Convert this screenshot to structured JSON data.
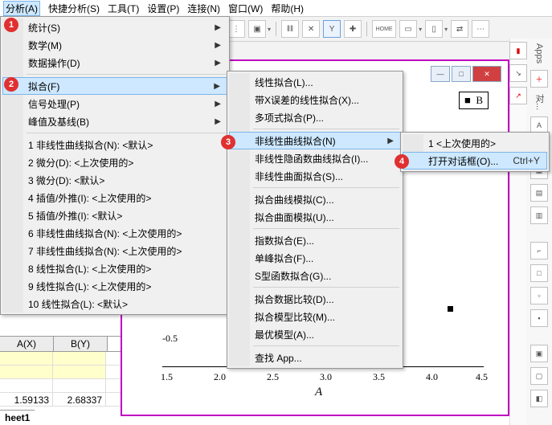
{
  "menubar": {
    "items": [
      "分析(A)",
      "快捷分析(S)",
      "工具(T)",
      "设置(P)",
      "连接(N)",
      "窗口(W)",
      "帮助(H)"
    ]
  },
  "menu1": {
    "items": [
      {
        "label": "统计(S)",
        "arrow": true
      },
      {
        "label": "数学(M)",
        "arrow": true
      },
      {
        "label": "数据操作(D)",
        "arrow": true
      },
      {
        "sep": true
      },
      {
        "label": "拟合(F)",
        "arrow": true,
        "sel": true
      },
      {
        "label": "信号处理(P)",
        "arrow": true
      },
      {
        "label": "峰值及基线(B)",
        "arrow": true
      },
      {
        "sep": true
      },
      {
        "label": "1 非线性曲线拟合(N): <默认>"
      },
      {
        "label": "2 微分(D): <上次使用的>"
      },
      {
        "label": "3 微分(D): <默认>"
      },
      {
        "label": "4 插值/外推(I): <上次使用的>"
      },
      {
        "label": "5 插值/外推(I): <默认>"
      },
      {
        "label": "6 非线性曲线拟合(N): <上次使用的>"
      },
      {
        "label": "7 非线性曲线拟合(N): <上次使用的>"
      },
      {
        "label": "8 线性拟合(L): <上次使用的>"
      },
      {
        "label": "9 线性拟合(L): <上次使用的>"
      },
      {
        "label": "10 线性拟合(L): <默认>"
      }
    ]
  },
  "menu2": {
    "items": [
      {
        "label": "线性拟合(L)..."
      },
      {
        "label": "带X误差的线性拟合(X)..."
      },
      {
        "label": "多项式拟合(P)..."
      },
      {
        "sep": true
      },
      {
        "label": "非线性曲线拟合(N)",
        "arrow": true,
        "sel": true
      },
      {
        "label": "非线性隐函数曲线拟合(I)..."
      },
      {
        "label": "非线性曲面拟合(S)..."
      },
      {
        "sep": true
      },
      {
        "label": "拟合曲线模拟(C)..."
      },
      {
        "label": "拟合曲面模拟(U)..."
      },
      {
        "sep": true
      },
      {
        "label": "指数拟合(E)..."
      },
      {
        "label": "单峰拟合(F)..."
      },
      {
        "label": "S型函数拟合(G)..."
      },
      {
        "sep": true
      },
      {
        "label": "拟合数据比较(D)..."
      },
      {
        "label": "拟合模型比较(M)..."
      },
      {
        "label": "最优模型(A)..."
      },
      {
        "sep": true
      },
      {
        "label": "查找 App..."
      }
    ]
  },
  "menu3": {
    "items": [
      {
        "label": "1 <上次使用的>"
      },
      {
        "label": "打开对话框(O)...",
        "sel": true,
        "shortcut": "Ctrl+Y"
      }
    ]
  },
  "badges": {
    "b1": "1",
    "b2": "2",
    "b3": "3",
    "b4": "4"
  },
  "toolbar": {
    "home": "HOME"
  },
  "plot": {
    "legend": "B",
    "axis_label": "A",
    "ticks": [
      "1.5",
      "2.0",
      "2.5",
      "3.0",
      "3.5",
      "4.0",
      "4.5"
    ],
    "ytick": "-0.5"
  },
  "worksheet": {
    "headers": [
      "A(X)",
      "B(Y)"
    ],
    "rows": [
      [
        "",
        ""
      ],
      [
        "",
        ""
      ],
      [
        "",
        ""
      ],
      [
        "1.59133",
        "2.68337"
      ]
    ],
    "sheet": "heet1"
  },
  "rightdock": {
    "apps": "Apps",
    "obj": "对..."
  }
}
